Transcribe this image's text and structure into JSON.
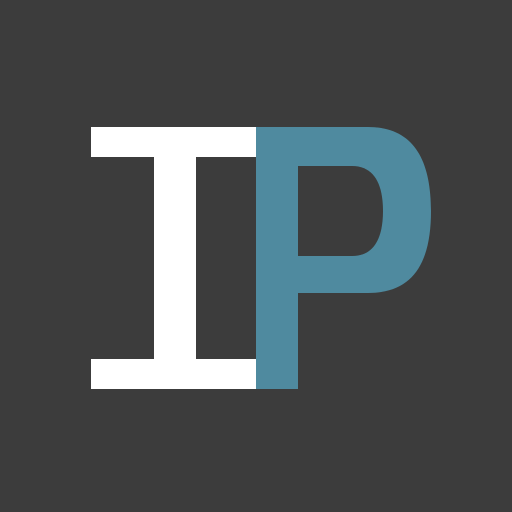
{
  "logo": {
    "text": "IP",
    "letters": [
      "I",
      "P"
    ]
  },
  "colors": {
    "background": "#3c3c3c",
    "letter_i": "#ffffff",
    "letter_p": "#4f8a9f",
    "p_counter": "#3c3c3c"
  }
}
